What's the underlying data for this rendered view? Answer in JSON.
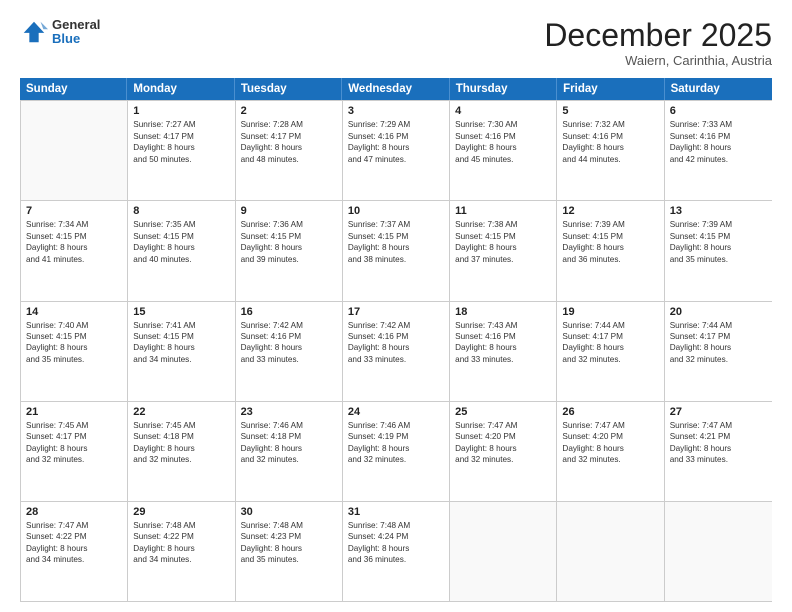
{
  "header": {
    "logo": {
      "general": "General",
      "blue": "Blue"
    },
    "month_title": "December 2025",
    "location": "Waiern, Carinthia, Austria"
  },
  "weekdays": [
    "Sunday",
    "Monday",
    "Tuesday",
    "Wednesday",
    "Thursday",
    "Friday",
    "Saturday"
  ],
  "weeks": [
    [
      {
        "day": "",
        "lines": []
      },
      {
        "day": "1",
        "lines": [
          "Sunrise: 7:27 AM",
          "Sunset: 4:17 PM",
          "Daylight: 8 hours",
          "and 50 minutes."
        ]
      },
      {
        "day": "2",
        "lines": [
          "Sunrise: 7:28 AM",
          "Sunset: 4:17 PM",
          "Daylight: 8 hours",
          "and 48 minutes."
        ]
      },
      {
        "day": "3",
        "lines": [
          "Sunrise: 7:29 AM",
          "Sunset: 4:16 PM",
          "Daylight: 8 hours",
          "and 47 minutes."
        ]
      },
      {
        "day": "4",
        "lines": [
          "Sunrise: 7:30 AM",
          "Sunset: 4:16 PM",
          "Daylight: 8 hours",
          "and 45 minutes."
        ]
      },
      {
        "day": "5",
        "lines": [
          "Sunrise: 7:32 AM",
          "Sunset: 4:16 PM",
          "Daylight: 8 hours",
          "and 44 minutes."
        ]
      },
      {
        "day": "6",
        "lines": [
          "Sunrise: 7:33 AM",
          "Sunset: 4:16 PM",
          "Daylight: 8 hours",
          "and 42 minutes."
        ]
      }
    ],
    [
      {
        "day": "7",
        "lines": [
          "Sunrise: 7:34 AM",
          "Sunset: 4:15 PM",
          "Daylight: 8 hours",
          "and 41 minutes."
        ]
      },
      {
        "day": "8",
        "lines": [
          "Sunrise: 7:35 AM",
          "Sunset: 4:15 PM",
          "Daylight: 8 hours",
          "and 40 minutes."
        ]
      },
      {
        "day": "9",
        "lines": [
          "Sunrise: 7:36 AM",
          "Sunset: 4:15 PM",
          "Daylight: 8 hours",
          "and 39 minutes."
        ]
      },
      {
        "day": "10",
        "lines": [
          "Sunrise: 7:37 AM",
          "Sunset: 4:15 PM",
          "Daylight: 8 hours",
          "and 38 minutes."
        ]
      },
      {
        "day": "11",
        "lines": [
          "Sunrise: 7:38 AM",
          "Sunset: 4:15 PM",
          "Daylight: 8 hours",
          "and 37 minutes."
        ]
      },
      {
        "day": "12",
        "lines": [
          "Sunrise: 7:39 AM",
          "Sunset: 4:15 PM",
          "Daylight: 8 hours",
          "and 36 minutes."
        ]
      },
      {
        "day": "13",
        "lines": [
          "Sunrise: 7:39 AM",
          "Sunset: 4:15 PM",
          "Daylight: 8 hours",
          "and 35 minutes."
        ]
      }
    ],
    [
      {
        "day": "14",
        "lines": [
          "Sunrise: 7:40 AM",
          "Sunset: 4:15 PM",
          "Daylight: 8 hours",
          "and 35 minutes."
        ]
      },
      {
        "day": "15",
        "lines": [
          "Sunrise: 7:41 AM",
          "Sunset: 4:15 PM",
          "Daylight: 8 hours",
          "and 34 minutes."
        ]
      },
      {
        "day": "16",
        "lines": [
          "Sunrise: 7:42 AM",
          "Sunset: 4:16 PM",
          "Daylight: 8 hours",
          "and 33 minutes."
        ]
      },
      {
        "day": "17",
        "lines": [
          "Sunrise: 7:42 AM",
          "Sunset: 4:16 PM",
          "Daylight: 8 hours",
          "and 33 minutes."
        ]
      },
      {
        "day": "18",
        "lines": [
          "Sunrise: 7:43 AM",
          "Sunset: 4:16 PM",
          "Daylight: 8 hours",
          "and 33 minutes."
        ]
      },
      {
        "day": "19",
        "lines": [
          "Sunrise: 7:44 AM",
          "Sunset: 4:17 PM",
          "Daylight: 8 hours",
          "and 32 minutes."
        ]
      },
      {
        "day": "20",
        "lines": [
          "Sunrise: 7:44 AM",
          "Sunset: 4:17 PM",
          "Daylight: 8 hours",
          "and 32 minutes."
        ]
      }
    ],
    [
      {
        "day": "21",
        "lines": [
          "Sunrise: 7:45 AM",
          "Sunset: 4:17 PM",
          "Daylight: 8 hours",
          "and 32 minutes."
        ]
      },
      {
        "day": "22",
        "lines": [
          "Sunrise: 7:45 AM",
          "Sunset: 4:18 PM",
          "Daylight: 8 hours",
          "and 32 minutes."
        ]
      },
      {
        "day": "23",
        "lines": [
          "Sunrise: 7:46 AM",
          "Sunset: 4:18 PM",
          "Daylight: 8 hours",
          "and 32 minutes."
        ]
      },
      {
        "day": "24",
        "lines": [
          "Sunrise: 7:46 AM",
          "Sunset: 4:19 PM",
          "Daylight: 8 hours",
          "and 32 minutes."
        ]
      },
      {
        "day": "25",
        "lines": [
          "Sunrise: 7:47 AM",
          "Sunset: 4:20 PM",
          "Daylight: 8 hours",
          "and 32 minutes."
        ]
      },
      {
        "day": "26",
        "lines": [
          "Sunrise: 7:47 AM",
          "Sunset: 4:20 PM",
          "Daylight: 8 hours",
          "and 32 minutes."
        ]
      },
      {
        "day": "27",
        "lines": [
          "Sunrise: 7:47 AM",
          "Sunset: 4:21 PM",
          "Daylight: 8 hours",
          "and 33 minutes."
        ]
      }
    ],
    [
      {
        "day": "28",
        "lines": [
          "Sunrise: 7:47 AM",
          "Sunset: 4:22 PM",
          "Daylight: 8 hours",
          "and 34 minutes."
        ]
      },
      {
        "day": "29",
        "lines": [
          "Sunrise: 7:48 AM",
          "Sunset: 4:22 PM",
          "Daylight: 8 hours",
          "and 34 minutes."
        ]
      },
      {
        "day": "30",
        "lines": [
          "Sunrise: 7:48 AM",
          "Sunset: 4:23 PM",
          "Daylight: 8 hours",
          "and 35 minutes."
        ]
      },
      {
        "day": "31",
        "lines": [
          "Sunrise: 7:48 AM",
          "Sunset: 4:24 PM",
          "Daylight: 8 hours",
          "and 36 minutes."
        ]
      },
      {
        "day": "",
        "lines": []
      },
      {
        "day": "",
        "lines": []
      },
      {
        "day": "",
        "lines": []
      }
    ]
  ]
}
